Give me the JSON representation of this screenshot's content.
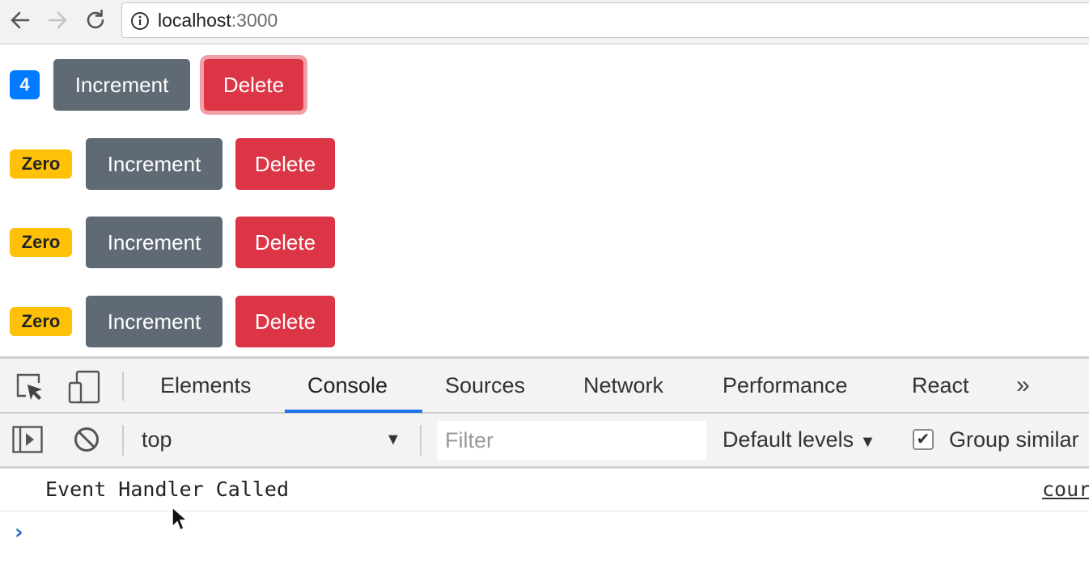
{
  "browser": {
    "url_host": "localhost",
    "url_port": ":3000"
  },
  "counters": [
    {
      "badge": "4",
      "badge_style": "primary",
      "increment_label": "Increment",
      "delete_label": "Delete",
      "delete_focused": true
    },
    {
      "badge": "Zero",
      "badge_style": "warning",
      "increment_label": "Increment",
      "delete_label": "Delete",
      "delete_focused": false
    },
    {
      "badge": "Zero",
      "badge_style": "warning",
      "increment_label": "Increment",
      "delete_label": "Delete",
      "delete_focused": false
    },
    {
      "badge": "Zero",
      "badge_style": "warning",
      "increment_label": "Increment",
      "delete_label": "Delete",
      "delete_focused": false
    }
  ],
  "devtools": {
    "tabs": [
      {
        "label": "Elements"
      },
      {
        "label": "Console",
        "active": true
      },
      {
        "label": "Sources"
      },
      {
        "label": "Network"
      },
      {
        "label": "Performance"
      },
      {
        "label": "React"
      }
    ],
    "more_tabs_glyph": "»",
    "console": {
      "context": "top",
      "filter_placeholder": "Filter",
      "levels_label": "Default levels",
      "group_similar_label": "Group similar",
      "group_similar_checked": true,
      "log_message": "Event Handler Called",
      "log_source": "cour",
      "prompt_glyph": "›"
    }
  },
  "colors": {
    "primary": "#007bff",
    "warning": "#ffc107",
    "secondary": "#5f6a74",
    "danger": "#dc3545",
    "devtools_active_tab": "#1a73e8"
  },
  "icons": [
    "back-arrow-icon",
    "forward-arrow-icon",
    "reload-icon",
    "info-icon",
    "inspect-element-icon",
    "device-toolbar-icon",
    "sidebar-toggle-icon",
    "clear-console-icon",
    "dropdown-arrow-icon",
    "checkbox-check-icon",
    "more-tabs-icon",
    "console-prompt-icon",
    "mouse-cursor-icon"
  ]
}
